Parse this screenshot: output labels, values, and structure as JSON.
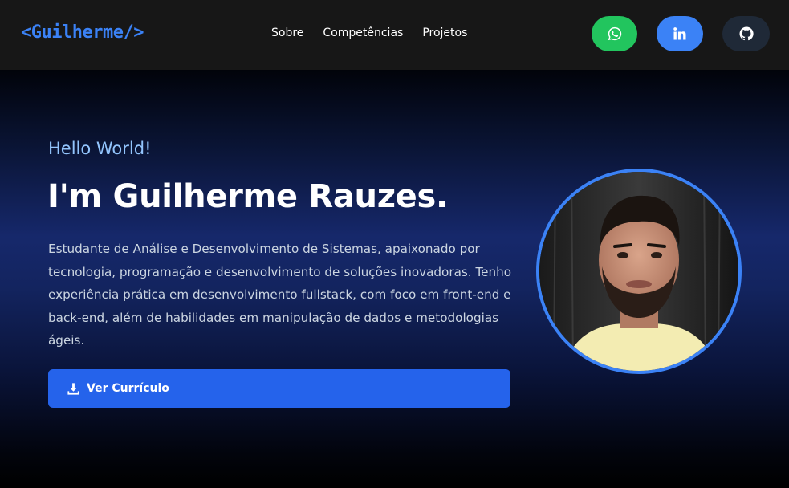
{
  "header": {
    "logo": "<Guilherme/>",
    "nav": [
      {
        "label": "Sobre"
      },
      {
        "label": "Competências"
      },
      {
        "label": "Projetos"
      }
    ],
    "social": [
      {
        "icon": "whatsapp-icon",
        "color": "#22c55e"
      },
      {
        "icon": "linkedin-icon",
        "color": "#3b82f6"
      },
      {
        "icon": "github-icon",
        "color": "#1f2937"
      }
    ]
  },
  "hero": {
    "greeting": "Hello World!",
    "title": "I'm Guilherme Rauzes.",
    "description": "Estudante de Análise e Desenvolvimento de Sistemas, apaixonado por tecnologia, programação e desenvolvimento de soluções inovadoras. Tenho experiência prática em desenvolvimento fullstack, com foco em front-end e back-end, além de habilidades em manipulação de dados e metodologias ágeis.",
    "cta_label": "Ver Currículo",
    "cta_icon": "download-icon"
  },
  "colors": {
    "accent": "#3b82f6",
    "button": "#2563eb",
    "greeting": "#93c5fd"
  }
}
